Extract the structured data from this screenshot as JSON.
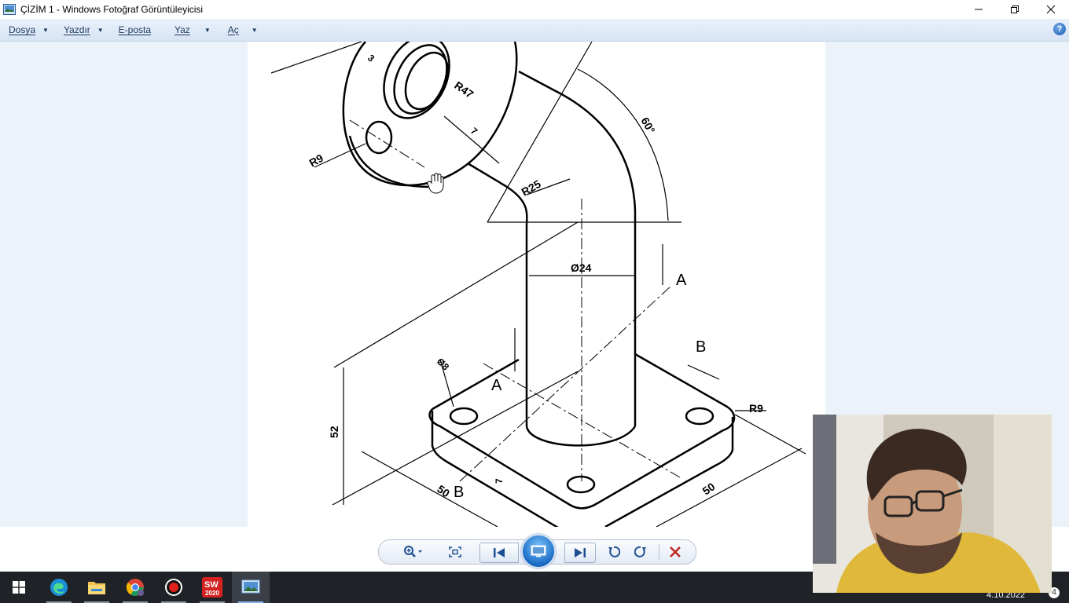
{
  "window": {
    "title": "ÇİZİM 1 - Windows Fotoğraf Görüntüleyicisi",
    "controls": {
      "minimize": "—",
      "restore": "❐",
      "close": "✕"
    }
  },
  "menu": {
    "items": [
      {
        "label": "Dosya",
        "has_dropdown": true
      },
      {
        "label": "Yazdır",
        "has_dropdown": true
      },
      {
        "label": "E-posta",
        "has_dropdown": false
      },
      {
        "label": "Yaz",
        "has_dropdown": true
      },
      {
        "label": "Aç",
        "has_dropdown": true
      }
    ],
    "help": "?"
  },
  "drawing": {
    "labels": {
      "r47": "R47",
      "dim3": "3",
      "dim7_top": "7",
      "r9_left": "R9",
      "r25": "R25",
      "angle60": "60°",
      "dia24": "Ø24",
      "section_a_right": "A",
      "section_a_left": "A",
      "section_b_right": "B",
      "section_b_left": "B",
      "dia8": "Ø8",
      "r9_right": "R9",
      "dim52": "52",
      "dim50_left": "50",
      "dim50_right": "50",
      "dim7_bottom": "7"
    }
  },
  "controls": {
    "zoom_icon": "zoom-icon",
    "fit_icon": "fit-to-window-icon",
    "previous_icon": "previous-icon",
    "slideshow_icon": "slideshow-icon",
    "next_icon": "next-icon",
    "rotate_left_icon": "rotate-counterclockwise-icon",
    "rotate_right_icon": "rotate-clockwise-icon",
    "delete_icon": "delete-icon"
  },
  "taskbar": {
    "apps": [
      "start",
      "edge",
      "file-explorer",
      "chrome",
      "recorder",
      "solidworks",
      "photo-viewer"
    ],
    "solidworks_badge": "2020",
    "clock_date": "4.10.2022",
    "notification_count": "4"
  }
}
